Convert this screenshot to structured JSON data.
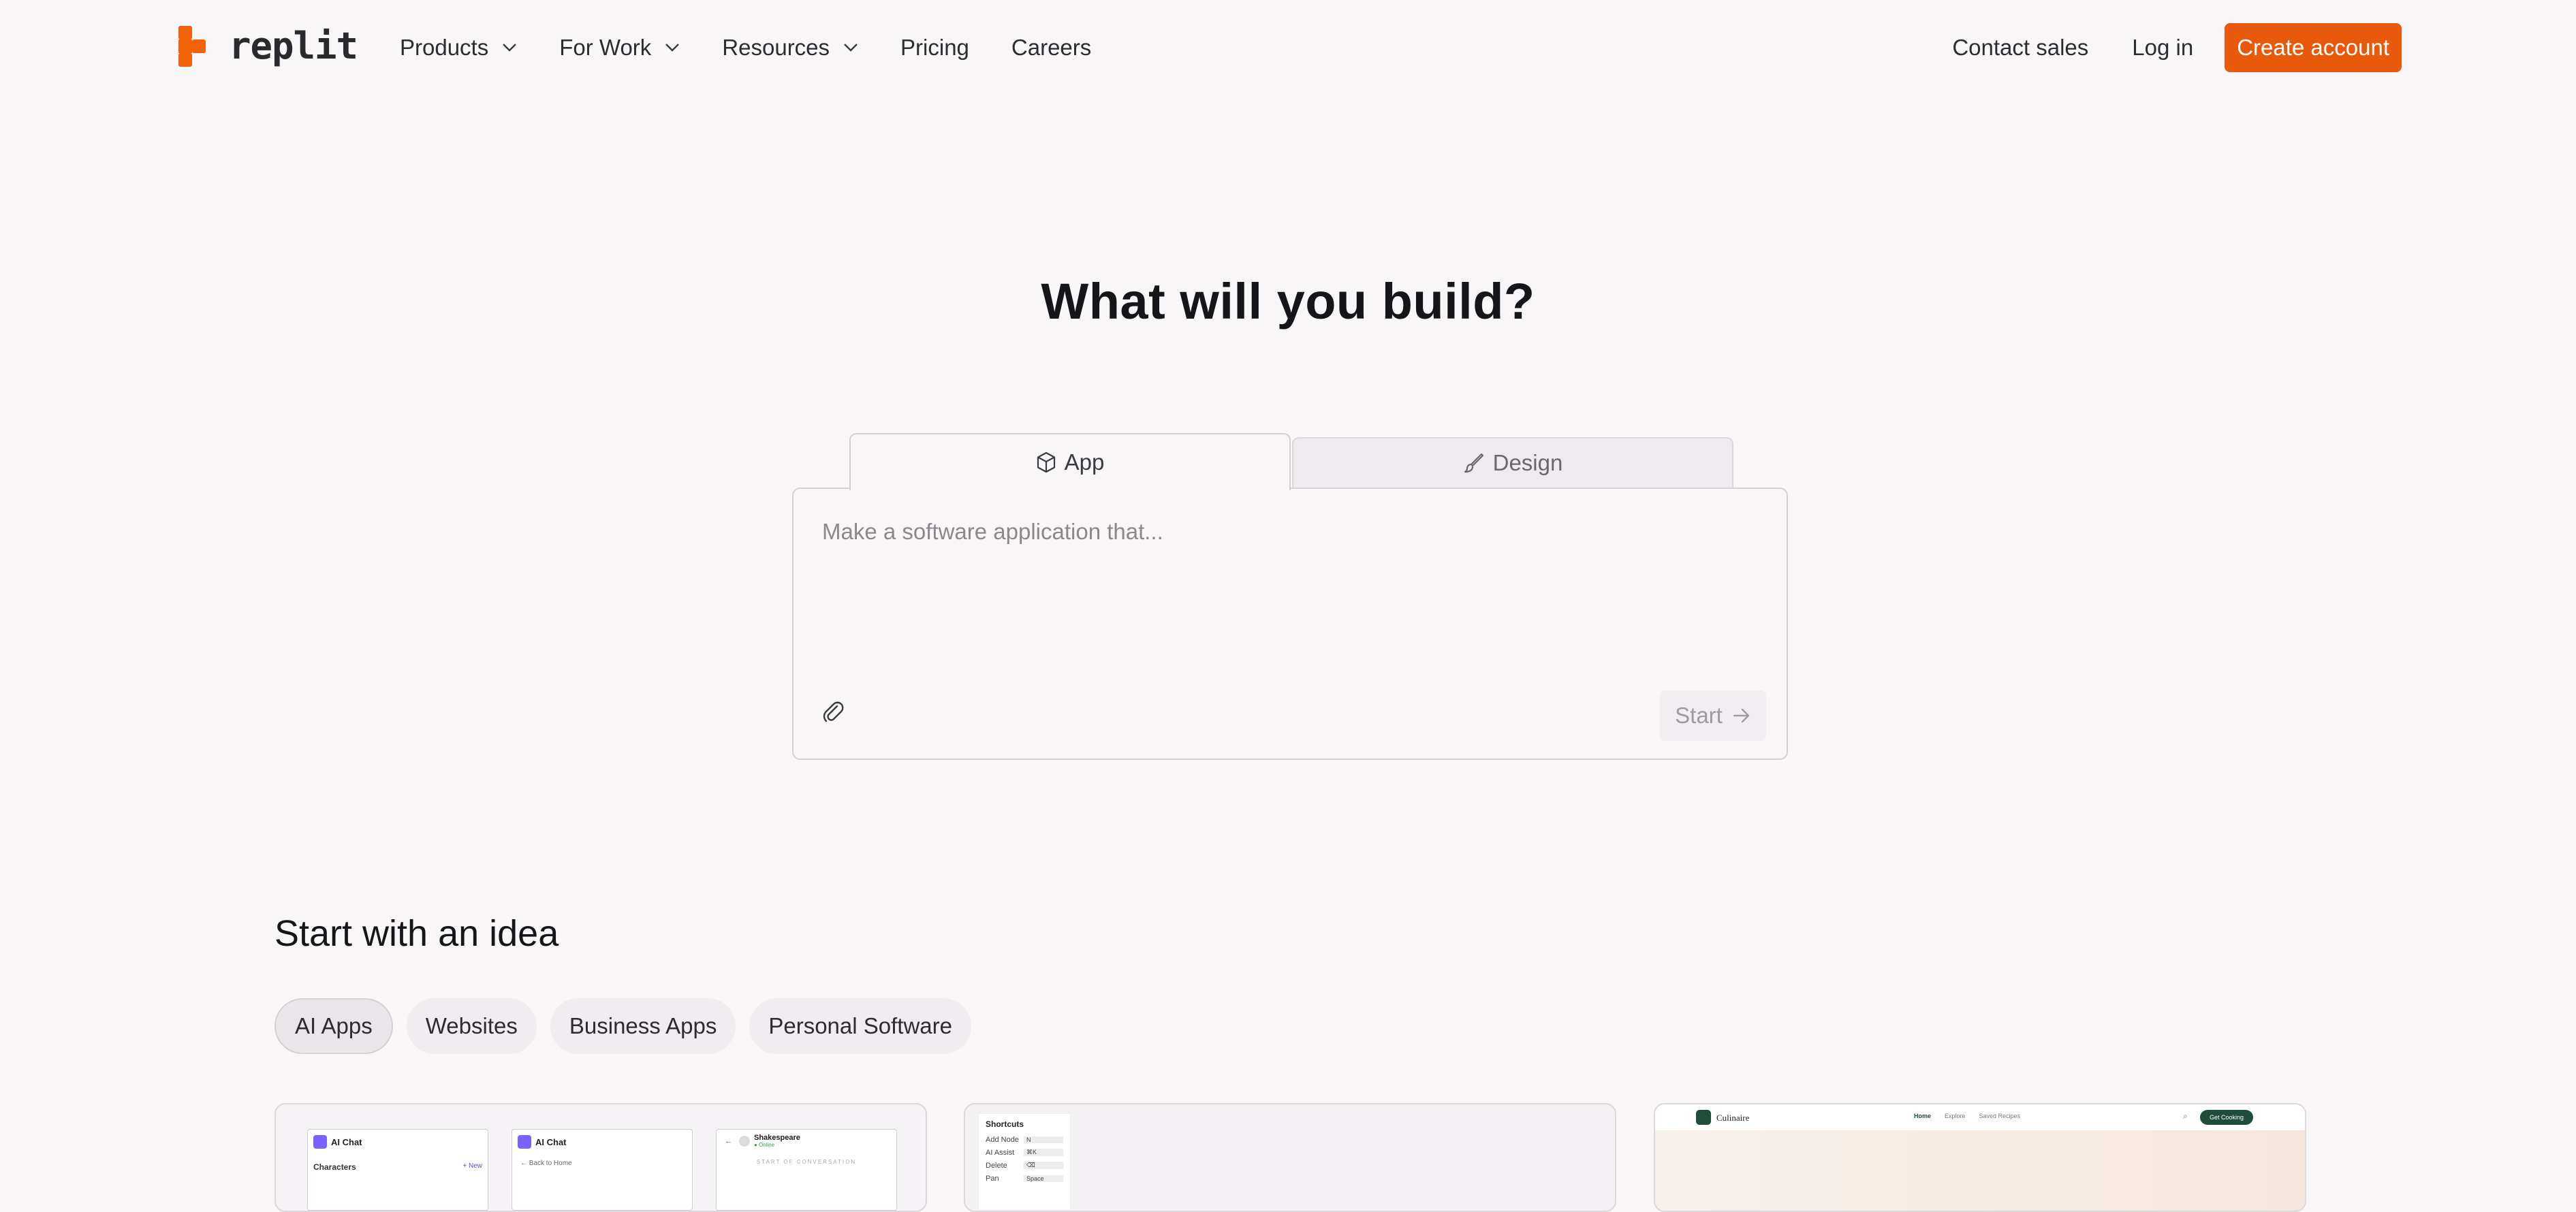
{
  "nav": {
    "brand": "replit",
    "items": [
      {
        "label": "Products",
        "dropdown": true
      },
      {
        "label": "For Work",
        "dropdown": true
      },
      {
        "label": "Resources",
        "dropdown": true
      },
      {
        "label": "Pricing",
        "dropdown": false
      },
      {
        "label": "Careers",
        "dropdown": false
      }
    ],
    "contact_sales": "Contact sales",
    "log_in": "Log in",
    "create_account": "Create account"
  },
  "hero": {
    "title": "What will you build?",
    "tabs": [
      {
        "label": "App",
        "icon": "cube-icon",
        "selected": true
      },
      {
        "label": "Design",
        "icon": "brush-icon",
        "selected": false
      }
    ],
    "prompt_placeholder": "Make a software application that...",
    "start_label": "Start"
  },
  "ideas": {
    "title": "Start with an idea",
    "chips": [
      {
        "label": "AI Apps",
        "selected": true
      },
      {
        "label": "Websites",
        "selected": false
      },
      {
        "label": "Business Apps",
        "selected": false
      },
      {
        "label": "Personal Software",
        "selected": false
      }
    ],
    "cards": {
      "ai_chat": {
        "app_name": "AI Chat",
        "characters": "Characters",
        "new": "+ New",
        "back": "← Back to Home",
        "persona": "Shakespeare",
        "status": "● Online",
        "divider": "START OF CONVERSATION"
      },
      "shortcuts": {
        "title": "Shortcuts",
        "rows": [
          {
            "action": "Add Node",
            "key": "N"
          },
          {
            "action": "AI Assist",
            "key": "⌘K"
          },
          {
            "action": "Delete",
            "key": "⌫"
          },
          {
            "action": "Pan",
            "key": "Space"
          }
        ]
      },
      "culinaire": {
        "brand": "Culinaire",
        "links": [
          "Home",
          "Explore",
          "Saved Recipes"
        ],
        "cta": "Get Cooking"
      }
    }
  },
  "colors": {
    "accent": "#e8590c",
    "background": "#f9f6f8"
  }
}
